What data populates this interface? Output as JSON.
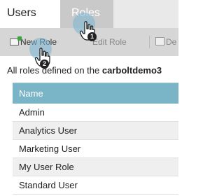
{
  "tabs": {
    "users": "Users",
    "roles": "Roles"
  },
  "toolbar": {
    "new_role": "New Role",
    "edit_role": "Edit Role",
    "delete": "De"
  },
  "description": {
    "prefix": "All roles defined on the ",
    "instance": "carboltdemo3"
  },
  "grid": {
    "header": "Name",
    "rows": [
      "Admin",
      "Analytics User",
      "Marketing User",
      "My User Role",
      "Standard User"
    ]
  },
  "callouts": {
    "step1": "1",
    "step2": "2"
  }
}
